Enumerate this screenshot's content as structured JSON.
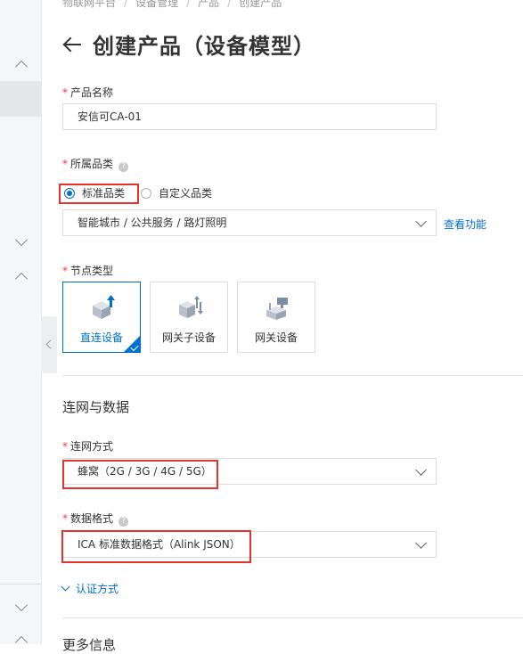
{
  "breadcrumb": [
    "物联网平台",
    "设备管理",
    "产品",
    "创建产品"
  ],
  "page_title": "创建产品（设备模型）",
  "product_name": {
    "label": "产品名称",
    "value": "安信可CA-01"
  },
  "category": {
    "label": "所属品类",
    "options": [
      "标准品类",
      "自定义品类"
    ],
    "selected_index": 0,
    "select_value": "智能城市 / 公共服务 / 路灯照明",
    "link": "查看功能"
  },
  "node_type": {
    "label": "节点类型",
    "cards": [
      "直连设备",
      "网关子设备",
      "网关设备"
    ],
    "selected_index": 0
  },
  "section_network": "连网与数据",
  "network": {
    "label": "连网方式",
    "value": "蜂窝（2G / 3G / 4G / 5G）"
  },
  "data_format": {
    "label": "数据格式",
    "value": "ICA 标准数据格式（Alink JSON）"
  },
  "auth_toggle": "认证方式",
  "next_section_partial": "更多信息",
  "colors": {
    "accent": "#0070cc",
    "required": "#f04134",
    "highlight_box": "#e8322d"
  }
}
